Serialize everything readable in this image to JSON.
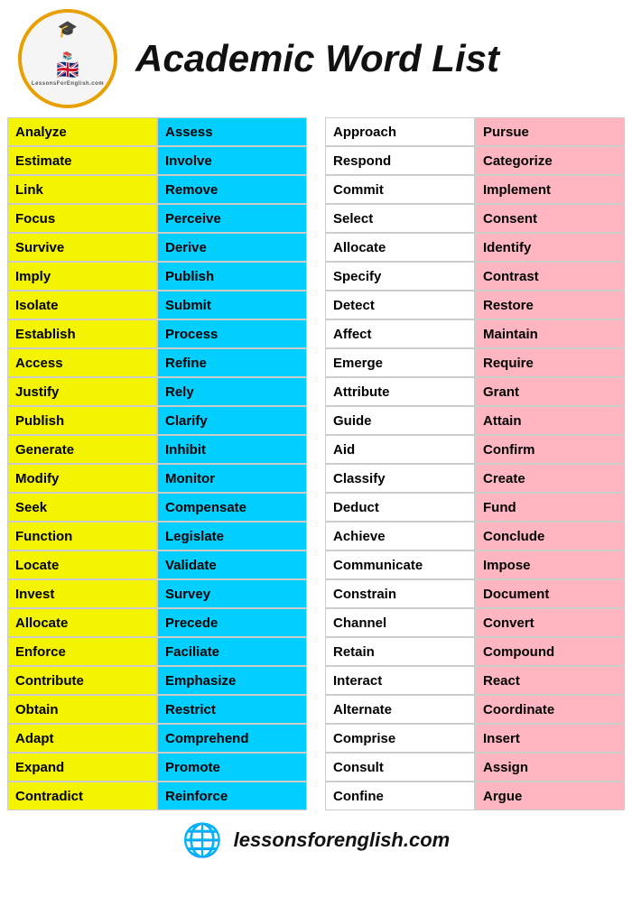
{
  "header": {
    "title": "Academic Word List",
    "logo_top": "LessonsFor",
    "logo_bottom": "English.com",
    "footer_url": "lessonsforenglish.com"
  },
  "left_col1": [
    "Analyze",
    "Estimate",
    "Link",
    "Focus",
    "Survive",
    "Imply",
    "Isolate",
    "Establish",
    "Access",
    "Justify",
    "Publish",
    "Generate",
    "Modify",
    "Seek",
    "Function",
    "Locate",
    "Invest",
    "Allocate",
    "Enforce",
    "Contribute",
    "Obtain",
    "Adapt",
    "Expand",
    "Contradict"
  ],
  "left_col2": [
    "Assess",
    "Involve",
    "Remove",
    "Perceive",
    "Derive",
    "Publish",
    "Submit",
    "Process",
    "Refine",
    "Rely",
    "Clarify",
    "Inhibit",
    "Monitor",
    "Compensate",
    "Legislate",
    "Validate",
    "Survey",
    "Precede",
    "Faciliate",
    "Emphasize",
    "Restrict",
    "Comprehend",
    "Promote",
    "Reinforce"
  ],
  "right_col1": [
    "Approach",
    "Respond",
    "Commit",
    "Select",
    "Allocate",
    "Specify",
    "Detect",
    "Affect",
    "Emerge",
    "Attribute",
    "Guide",
    "Aid",
    "Classify",
    "Deduct",
    "Achieve",
    "Communicate",
    "Constrain",
    "Channel",
    "Retain",
    "Interact",
    "Alternate",
    "Comprise",
    "Consult",
    "Confine"
  ],
  "right_col2": [
    "Pursue",
    "Categorize",
    "Implement",
    "Consent",
    "Identify",
    "Contrast",
    "Restore",
    "Maintain",
    "Require",
    "Grant",
    "Attain",
    "Confirm",
    "Create",
    "Fund",
    "Conclude",
    "Impose",
    "Document",
    "Convert",
    "Compound",
    "React",
    "Coordinate",
    "Insert",
    "Assign",
    "Argue"
  ]
}
